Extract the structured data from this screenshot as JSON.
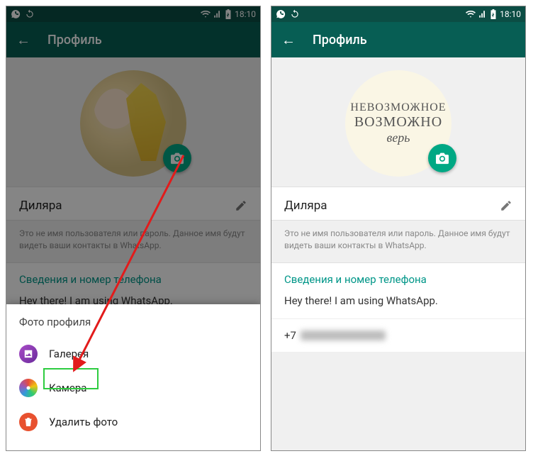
{
  "status_bar": {
    "time": "18:10",
    "icons": {
      "whatsapp": "whatsapp-icon",
      "sync": "sync-icon",
      "wifi": "wifi-icon",
      "signal": "signal-icon",
      "battery": "battery-icon"
    }
  },
  "header": {
    "back": "←",
    "title": "Профиль"
  },
  "profile": {
    "name": "Диляра",
    "hint": "Это не имя пользователя или пароль. Данное имя будут видеть ваши контакты в WhatsApp.",
    "section_title": "Сведения и номер телефона",
    "status": "Hey there! I am using WhatsApp.",
    "phone_prefix": "+7"
  },
  "avatar_text": {
    "line1": "НЕВОЗМОЖНОЕ",
    "line2": "ВОЗМОЖНО",
    "line3": "верь"
  },
  "sheet": {
    "title": "Фото профиля",
    "items": [
      {
        "label": "Галерея",
        "icon": "gallery"
      },
      {
        "label": "Камера",
        "icon": "camera"
      },
      {
        "label": "Удалить фото",
        "icon": "delete"
      }
    ]
  },
  "colors": {
    "primary": "#075E54",
    "accent": "#00a884",
    "teal_text": "#009688",
    "highlight": "#2ecc40",
    "arrow": "#e21b1b"
  }
}
